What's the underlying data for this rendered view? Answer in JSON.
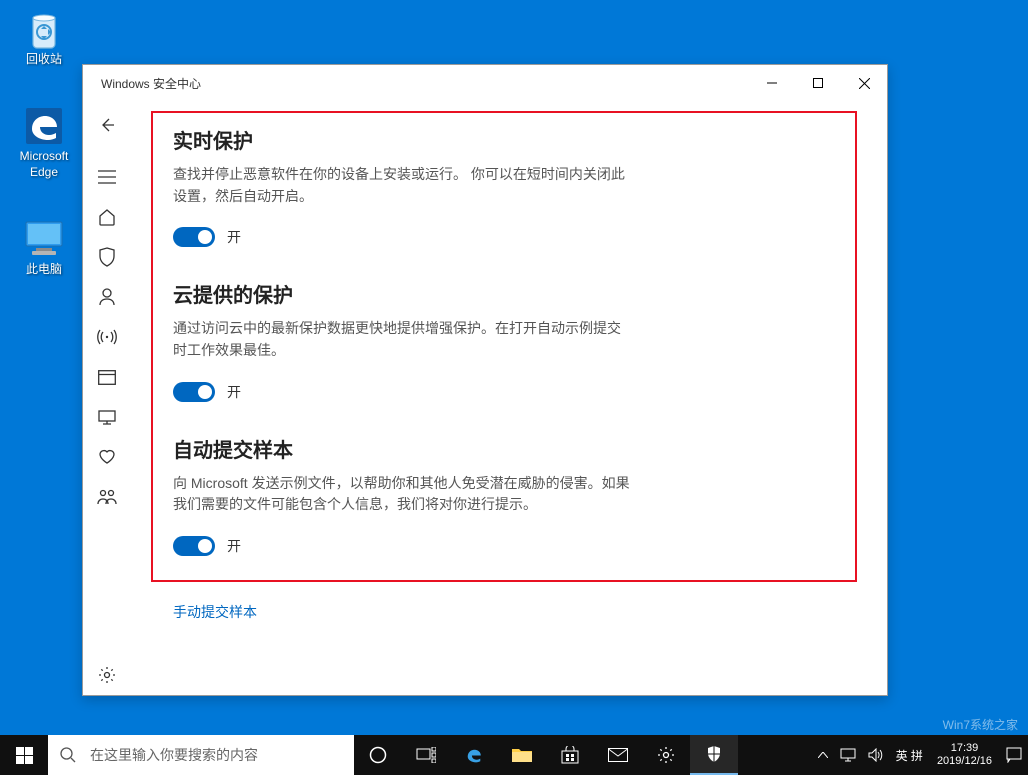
{
  "desktop": {
    "icons": [
      {
        "label": "回收站"
      },
      {
        "label": "Microsoft\nEdge"
      },
      {
        "label": "此电脑"
      }
    ]
  },
  "window": {
    "title": "Windows 安全中心",
    "sections": [
      {
        "title": "实时保护",
        "desc": "查找并停止恶意软件在你的设备上安装或运行。 你可以在短时间内关闭此设置，然后自动开启。",
        "toggle": "开"
      },
      {
        "title": "云提供的保护",
        "desc": "通过访问云中的最新保护数据更快地提供增强保护。在打开自动示例提交时工作效果最佳。",
        "toggle": "开"
      },
      {
        "title": "自动提交样本",
        "desc": "向 Microsoft 发送示例文件，以帮助你和其他人免受潜在威胁的侵害。如果我们需要的文件可能包含个人信息，我们将对你进行提示。",
        "toggle": "开"
      }
    ],
    "link": "手动提交样本"
  },
  "taskbar": {
    "search_placeholder": "在这里输入你要搜索的内容",
    "ime": "英 拼",
    "clock_time": "17:39",
    "clock_date": "2019/12/16"
  },
  "watermark": "Win7系统之家"
}
